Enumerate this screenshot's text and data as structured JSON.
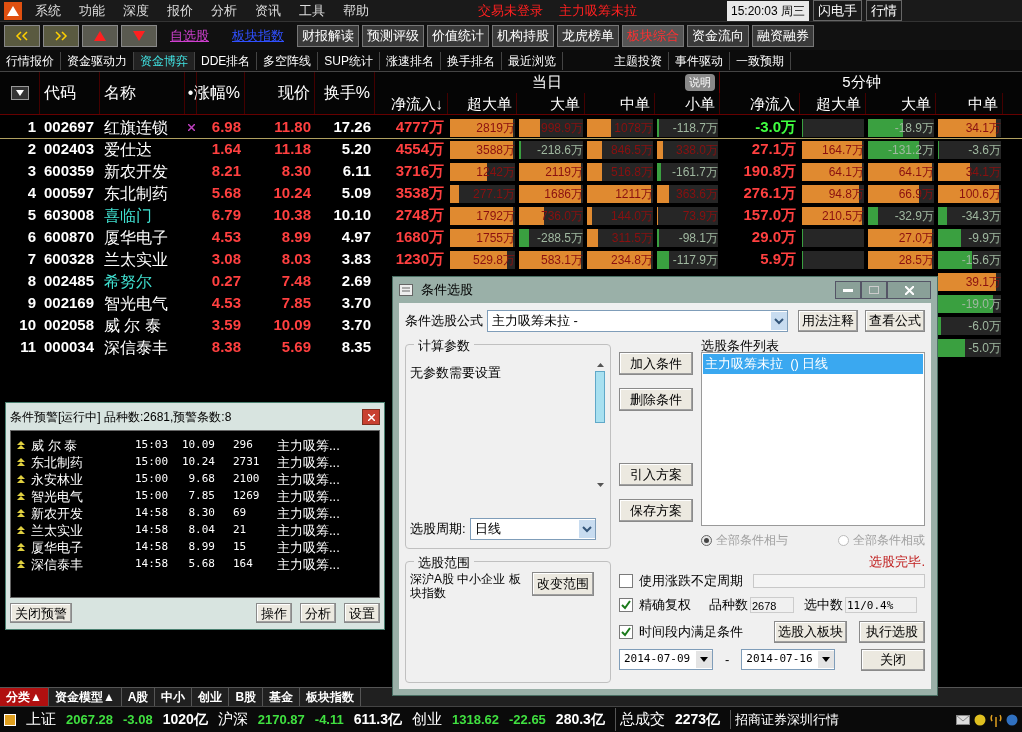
{
  "menu_bar": {
    "items": [
      "系统",
      "功能",
      "深度",
      "报价",
      "分析",
      "资讯",
      "工具",
      "帮助"
    ],
    "notices": [
      "交易未登录",
      "主力吸筹未拉"
    ],
    "clock": "15:20:03 周三",
    "right_buttons": [
      "闪电手",
      "行情"
    ]
  },
  "toolbar": {
    "links": [
      {
        "label": "自选股",
        "color": "#d040d0"
      },
      {
        "label": "板块指数",
        "color": "#3050ff"
      }
    ],
    "buttons": [
      {
        "label": "财报解读",
        "selected": false
      },
      {
        "label": "预测评级",
        "selected": false
      },
      {
        "label": "价值统计",
        "selected": false
      },
      {
        "label": "机构持股",
        "selected": false
      },
      {
        "label": "龙虎榜单",
        "selected": false
      },
      {
        "label": "板块综合",
        "selected": true
      },
      {
        "label": "资金流向",
        "selected": false
      },
      {
        "label": "融资融券",
        "selected": false
      }
    ]
  },
  "tabs": [
    {
      "label": "行情报价",
      "selected": false
    },
    {
      "label": "资金驱动力",
      "selected": false
    },
    {
      "label": "资金博弈",
      "selected": true
    },
    {
      "label": "DDE排名",
      "selected": false
    },
    {
      "label": "多空阵线",
      "selected": false
    },
    {
      "label": "SUP统计",
      "selected": false
    },
    {
      "label": "涨速排名",
      "selected": false
    },
    {
      "label": "换手排名",
      "selected": false
    },
    {
      "label": "最近浏览",
      "selected": false
    }
  ],
  "tabs_right": [
    {
      "label": "主题投资",
      "selected": false
    },
    {
      "label": "事件驱动",
      "selected": false
    },
    {
      "label": "一致预期",
      "selected": false
    }
  ],
  "table": {
    "columns": [
      "代码",
      "名称",
      "•",
      "涨幅%",
      "现价",
      "换手%"
    ],
    "group_day": "当日",
    "explain_button": "说明",
    "group_5min": "5分钟",
    "sub_columns": [
      "净流入↓",
      "超大单",
      "大单",
      "中单",
      "小单",
      "净流入",
      "超大单",
      "大单",
      "中单"
    ],
    "rows": [
      {
        "rank": "1",
        "code": "002697",
        "name": "红旗连锁",
        "marked": false,
        "flagged": true,
        "selected": true,
        "change": "6.98",
        "price": "11.80",
        "turnover": "17.26",
        "cells": [
          {
            "kind": "net",
            "text": "4777万",
            "positive": true
          },
          {
            "kind": "bar",
            "text": "2819万",
            "level": 1,
            "positive": true
          },
          {
            "kind": "bar",
            "text": "998.9万",
            "level": 0.34,
            "positive": true
          },
          {
            "kind": "bar",
            "text": "1078万",
            "level": 0.37,
            "positive": true
          },
          {
            "kind": "bar",
            "text": "-118.7万",
            "level": 0.03,
            "positive": false
          },
          {
            "kind": "net",
            "text": "-3.0万",
            "positive": false
          },
          {
            "kind": "bar",
            "level": 0.02,
            "positive": false
          },
          {
            "kind": "bar",
            "text": "-18.9万",
            "level": 0.55,
            "positive": false
          },
          {
            "kind": "bar",
            "text": "34.1万",
            "level": 0.95,
            "positive": true
          }
        ]
      },
      {
        "rank": "2",
        "code": "002403",
        "name": "爱仕达",
        "marked": false,
        "flagged": false,
        "selected": false,
        "change": "1.64",
        "price": "11.18",
        "turnover": "5.20",
        "cells": [
          {
            "kind": "net",
            "text": "4554万",
            "positive": true
          },
          {
            "kind": "bar",
            "text": "3588万",
            "level": 1,
            "positive": true
          },
          {
            "kind": "bar",
            "text": "-218.6万",
            "level": 0.04,
            "positive": false
          },
          {
            "kind": "bar",
            "text": "846.5万",
            "level": 0.24,
            "positive": true
          },
          {
            "kind": "bar",
            "text": "338.0万",
            "level": 0.1,
            "positive": true
          },
          {
            "kind": "net",
            "text": "27.1万",
            "positive": true
          },
          {
            "kind": "bar",
            "text": "164.7万",
            "level": 1,
            "positive": true
          },
          {
            "kind": "bar",
            "text": "-131.2万",
            "level": 0.8,
            "positive": false
          },
          {
            "kind": "bar",
            "text": "-3.6万",
            "level": 0.02,
            "positive": false
          }
        ]
      },
      {
        "rank": "3",
        "code": "600359",
        "name": "新农开发",
        "marked": false,
        "flagged": false,
        "selected": false,
        "change": "8.21",
        "price": "8.30",
        "turnover": "6.11",
        "cells": [
          {
            "kind": "net",
            "text": "3716万",
            "positive": true
          },
          {
            "kind": "bar",
            "text": "1242万",
            "level": 0.58,
            "positive": true
          },
          {
            "kind": "bar",
            "text": "2119万",
            "level": 1,
            "positive": true
          },
          {
            "kind": "bar",
            "text": "516.8万",
            "level": 0.24,
            "positive": true
          },
          {
            "kind": "bar",
            "text": "-161.7万",
            "level": 0.06,
            "positive": false
          },
          {
            "kind": "net",
            "text": "190.8万",
            "positive": true
          },
          {
            "kind": "bar",
            "text": "64.1万",
            "level": 1,
            "positive": true
          },
          {
            "kind": "bar",
            "text": "64.1万",
            "level": 1,
            "positive": true
          },
          {
            "kind": "bar",
            "text": "34.1万",
            "level": 0.53,
            "positive": true
          }
        ]
      },
      {
        "rank": "4",
        "code": "000597",
        "name": "东北制药",
        "marked": false,
        "flagged": false,
        "selected": false,
        "change": "5.68",
        "price": "10.24",
        "turnover": "5.09",
        "cells": [
          {
            "kind": "net",
            "text": "3538万",
            "positive": true
          },
          {
            "kind": "bar",
            "text": "277.1万",
            "level": 0.15,
            "positive": true
          },
          {
            "kind": "bar",
            "text": "1686万",
            "level": 1,
            "positive": true
          },
          {
            "kind": "bar",
            "text": "1211万",
            "level": 1,
            "positive": true
          },
          {
            "kind": "bar",
            "text": "363.6万",
            "level": 0.2,
            "positive": true
          },
          {
            "kind": "net",
            "text": "276.1万",
            "positive": true
          },
          {
            "kind": "bar",
            "text": "94.8万",
            "level": 0.95,
            "positive": true
          },
          {
            "kind": "bar",
            "text": "66.9万",
            "level": 0.8,
            "positive": true
          },
          {
            "kind": "bar",
            "text": "100.6万",
            "level": 1,
            "positive": true
          }
        ]
      },
      {
        "rank": "5",
        "code": "603008",
        "name": "喜临门",
        "marked": true,
        "flagged": false,
        "selected": false,
        "change": "6.79",
        "price": "10.38",
        "turnover": "10.10",
        "cells": [
          {
            "kind": "net",
            "text": "2748万",
            "positive": true
          },
          {
            "kind": "bar",
            "text": "1792万",
            "level": 1,
            "positive": true
          },
          {
            "kind": "bar",
            "text": "736.0万",
            "level": 0.4,
            "positive": true
          },
          {
            "kind": "bar",
            "text": "144.0万",
            "level": 0.08,
            "positive": true
          },
          {
            "kind": "bar",
            "text": "73.9万",
            "level": 0.02,
            "positive": true
          },
          {
            "kind": "net",
            "text": "157.0万",
            "positive": true
          },
          {
            "kind": "bar",
            "text": "210.5万",
            "level": 1,
            "positive": true
          },
          {
            "kind": "bar",
            "text": "-32.9万",
            "level": 0.15,
            "positive": false
          },
          {
            "kind": "bar",
            "text": "-34.3万",
            "level": 0.15,
            "positive": false
          }
        ]
      },
      {
        "rank": "6",
        "code": "600870",
        "name": "厦华电子",
        "marked": false,
        "flagged": false,
        "selected": false,
        "change": "4.53",
        "price": "8.99",
        "turnover": "4.97",
        "cells": [
          {
            "kind": "net",
            "text": "1680万",
            "positive": true
          },
          {
            "kind": "bar",
            "text": "1755万",
            "level": 1,
            "positive": true
          },
          {
            "kind": "bar",
            "text": "-288.5万",
            "level": 0.16,
            "positive": false
          },
          {
            "kind": "bar",
            "text": "311.5万",
            "level": 0.17,
            "positive": true
          },
          {
            "kind": "bar",
            "text": "-98.1万",
            "level": 0.03,
            "positive": false
          },
          {
            "kind": "net",
            "text": "29.0万",
            "positive": true
          },
          {
            "kind": "bar",
            "level": 0.02,
            "positive": false
          },
          {
            "kind": "bar",
            "text": "27.0万",
            "level": 1,
            "positive": true
          },
          {
            "kind": "bar",
            "text": "-9.9万",
            "level": 0.37,
            "positive": false
          }
        ]
      },
      {
        "rank": "7",
        "code": "600328",
        "name": "兰太实业",
        "marked": false,
        "flagged": false,
        "selected": false,
        "change": "3.08",
        "price": "8.03",
        "turnover": "3.83",
        "cells": [
          {
            "kind": "net",
            "text": "1230万",
            "positive": true
          },
          {
            "kind": "bar",
            "text": "529.8万",
            "level": 0.9,
            "positive": true
          },
          {
            "kind": "bar",
            "text": "583.1万",
            "level": 1,
            "positive": true
          },
          {
            "kind": "bar",
            "text": "234.8万",
            "level": 1,
            "positive": true
          },
          {
            "kind": "bar",
            "text": "-117.9万",
            "level": 0.2,
            "positive": false
          },
          {
            "kind": "net",
            "text": "5.9万",
            "positive": true
          },
          {
            "kind": "bar",
            "level": 0.02,
            "positive": false
          },
          {
            "kind": "bar",
            "text": "28.5万",
            "level": 1,
            "positive": true
          },
          {
            "kind": "bar",
            "text": "-15.6万",
            "level": 0.55,
            "positive": false
          }
        ]
      },
      {
        "rank": "8",
        "code": "002485",
        "name": "希努尔",
        "marked": true,
        "flagged": false,
        "selected": false,
        "change": "0.27",
        "price": "7.48",
        "turnover": "2.69",
        "cells": [
          {
            "kind": "bar",
            "text": "39.1万",
            "level": 0.95,
            "positive": true
          }
        ]
      },
      {
        "rank": "9",
        "code": "002169",
        "name": "智光电气",
        "marked": false,
        "flagged": false,
        "selected": false,
        "change": "4.53",
        "price": "7.85",
        "turnover": "3.70",
        "cells": [
          {
            "kind": "bar",
            "text": "-19.0万",
            "level": 0.9,
            "positive": false
          }
        ]
      },
      {
        "rank": "10",
        "code": "002058",
        "name": "威 尔 泰",
        "marked": false,
        "flagged": false,
        "selected": false,
        "change": "3.59",
        "price": "10.09",
        "turnover": "3.70",
        "cells": [
          {
            "kind": "bar",
            "text": "-6.0万",
            "level": 0.05,
            "positive": false
          }
        ]
      },
      {
        "rank": "11",
        "code": "000034",
        "name": "深信泰丰",
        "marked": false,
        "flagged": false,
        "selected": false,
        "change": "8.38",
        "price": "5.69",
        "turnover": "8.35",
        "cells": [
          {
            "kind": "bar",
            "text": "-5.0万",
            "level": 0.45,
            "positive": false
          }
        ]
      }
    ]
  },
  "bottom_tabs": [
    {
      "label": "分类▲",
      "selected": true
    },
    {
      "label": "资金模型▲",
      "selected": false
    },
    {
      "label": "A股",
      "selected": false
    },
    {
      "label": "中小",
      "selected": false
    },
    {
      "label": "创业",
      "selected": false
    },
    {
      "label": "B股",
      "selected": false
    },
    {
      "label": "基金",
      "selected": false
    },
    {
      "label": "板块指数",
      "selected": false
    }
  ],
  "status_bar": {
    "indices": [
      {
        "name": "上证",
        "value": "2067.28",
        "change": "-3.08",
        "amount": "1020亿"
      },
      {
        "name": "沪深",
        "value": "2170.87",
        "change": "-4.11",
        "amount": "611.3亿"
      },
      {
        "name": "创业",
        "value": "1318.62",
        "change": "-22.65",
        "amount": "280.3亿"
      }
    ],
    "total_label": "总成交",
    "total": "2273亿",
    "broker": "招商证券深圳行情"
  },
  "alert_window": {
    "title": "条件预警[运行中] 品种数:2681,预警条数:8",
    "rows": [
      {
        "name": "威 尔 泰",
        "time": "15:03",
        "price": "10.09",
        "count": "296",
        "condition": "主力吸筹..."
      },
      {
        "name": "东北制药",
        "time": "15:00",
        "price": "10.24",
        "count": "2731",
        "condition": "主力吸筹..."
      },
      {
        "name": "永安林业",
        "time": "15:00",
        "price": "9.68",
        "count": "2100",
        "condition": "主力吸筹..."
      },
      {
        "name": "智光电气",
        "time": "15:00",
        "price": "7.85",
        "count": "1269",
        "condition": "主力吸筹..."
      },
      {
        "name": "新农开发",
        "time": "14:58",
        "price": "8.30",
        "count": "69",
        "condition": "主力吸筹..."
      },
      {
        "name": "兰太实业",
        "time": "14:58",
        "price": "8.04",
        "count": "21",
        "condition": "主力吸筹..."
      },
      {
        "name": "厦华电子",
        "time": "14:58",
        "price": "8.99",
        "count": "15",
        "condition": "主力吸筹..."
      },
      {
        "name": "深信泰丰",
        "time": "14:58",
        "price": "5.68",
        "count": "164",
        "condition": "主力吸筹..."
      }
    ],
    "buttons": [
      "关闭预警",
      "操作",
      "分析",
      "设置"
    ]
  },
  "dialog": {
    "title": "条件选股",
    "formula_label": "条件选股公式",
    "formula": "主力吸筹未拉 -",
    "formula_buttons": [
      "用法注释",
      "查看公式"
    ],
    "params_group": "计算参数",
    "params_text": "无参数需要设置",
    "period_label": "选股周期:",
    "period": "日线",
    "range_group": "选股范围",
    "range_text": "深沪A股 中小企业 板块指数",
    "range_button": "改变范围",
    "middle_buttons": [
      "加入条件",
      "删除条件",
      "引入方案",
      "保存方案"
    ],
    "list_label": "选股条件列表",
    "conditions": [
      {
        "text": "主力吸筹未拉  () 日线",
        "selected": true
      }
    ],
    "logic": [
      {
        "label": "全部条件相与",
        "selected": true,
        "disabled": true
      },
      {
        "label": "全部条件相或",
        "selected": false,
        "disabled": true
      }
    ],
    "status": "选股完毕.",
    "use_period": {
      "label": "使用涨跌不定周期",
      "checked": false
    },
    "exact": {
      "label": "精确复权",
      "checked": true
    },
    "count_label": "品种数",
    "count": "2678",
    "selected_label": "选中数",
    "selected_value": "11/0.4%",
    "in_range": {
      "label": "时间段内满足条件",
      "checked": true
    },
    "action_buttons": [
      "选股入板块",
      "执行选股"
    ],
    "date_from": "2014-07-09",
    "date_sep": "-",
    "date_to": "2014-07-16",
    "close_button": "关闭"
  }
}
